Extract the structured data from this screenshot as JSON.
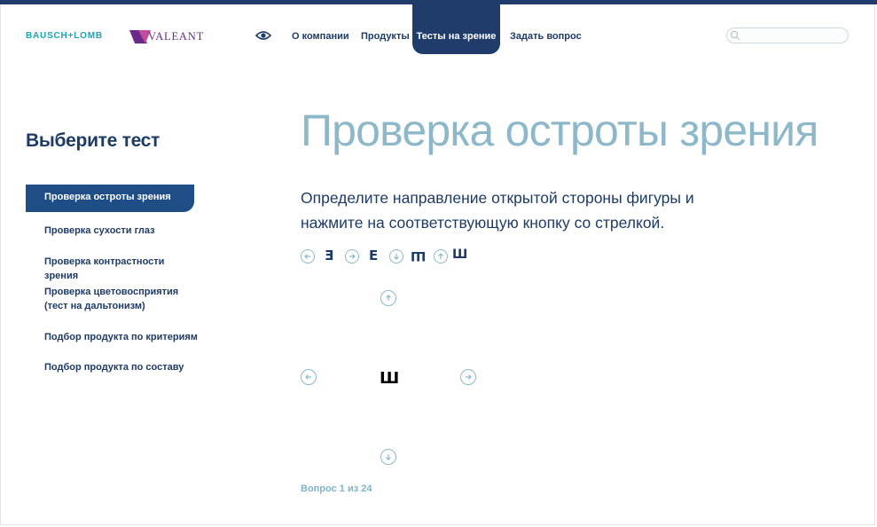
{
  "header": {
    "logo_bausch": "BAUSCH+LOMB",
    "logo_valeant": "VALEANT",
    "eye_icon": "eye-icon",
    "nav": [
      {
        "label": "О компании"
      },
      {
        "label": "Продукты"
      },
      {
        "label": "Тесты на зрение"
      },
      {
        "label": "Задать вопрос"
      }
    ],
    "search_placeholder": ""
  },
  "sidebar": {
    "title": "Выберите тест",
    "items": [
      {
        "label": "Проверка остроты зрения"
      },
      {
        "label": "Проверка сухости глаз"
      },
      {
        "label": "Проверка контрастности зрения"
      },
      {
        "label": "Проверка цветовосприятия (тест на дальтонизм)"
      },
      {
        "label": "Подбор продукта по критериям"
      },
      {
        "label": "Подбор продукта по составу"
      }
    ]
  },
  "main": {
    "title": "Проверка остроты зрения",
    "instruction": "Определите направление открытой стороны фигуры и нажмите на соответствующую кнопку со стрелкой.",
    "legend": [
      "Ǝ",
      "E",
      "Ш",
      "Ш"
    ],
    "current_symbol": "Ш",
    "counter": "Вопрос 1 из 24"
  },
  "colors": {
    "navy": "#1f3c6b",
    "accent_light": "#8db8ca",
    "active_item": "#1f4e86"
  }
}
